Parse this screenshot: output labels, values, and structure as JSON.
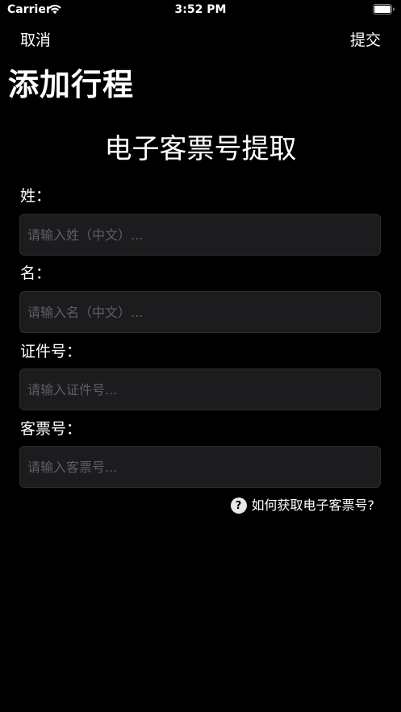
{
  "status_bar": {
    "carrier": "Carrier",
    "time": "3:52 PM",
    "wifi_icon": "wifi-icon",
    "battery_icon": "battery-icon"
  },
  "nav": {
    "cancel_label": "取消",
    "submit_label": "提交",
    "title": "添加行程"
  },
  "form": {
    "title": "电子客票号提取",
    "fields": [
      {
        "label": "姓：",
        "placeholder": "请输入姓（中文）..."
      },
      {
        "label": "名：",
        "placeholder": "请输入名（中文）..."
      },
      {
        "label": "证件号：",
        "placeholder": "请输入证件号..."
      },
      {
        "label": "客票号：",
        "placeholder": "请输入客票号..."
      }
    ],
    "help": {
      "icon": "question-circle-icon",
      "icon_glyph": "?",
      "label": "如何获取电子客票号?"
    }
  },
  "colors": {
    "background": "#000000",
    "field_background": "#1c1c1e",
    "placeholder": "#5f5f63",
    "text": "#ffffff"
  }
}
